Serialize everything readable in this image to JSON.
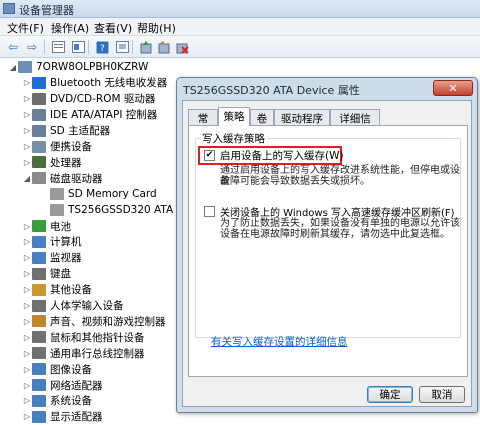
{
  "window": {
    "title": "设备管理器"
  },
  "menu": [
    "文件(F)",
    "操作(A)",
    "查看(V)",
    "帮助(H)"
  ],
  "toolbar": {
    "icons": [
      "back-arrow-icon",
      "forward-arrow-icon",
      "tree-view-icon",
      "properties-icon",
      "help-icon",
      "show-hidden-icon",
      "update-driver-icon",
      "uninstall-icon"
    ],
    "back": "⇦",
    "forward": "⇨"
  },
  "tree": {
    "root": "7ORW8OLPBH0KZRW",
    "items": [
      {
        "label": "Bluetooth 无线电收发器",
        "color": "#1e6fd1"
      },
      {
        "label": "DVD/CD-ROM 驱动器",
        "color": "#6d6d6d"
      },
      {
        "label": "IDE ATA/ATAPI 控制器",
        "color": "#6a7f99"
      },
      {
        "label": "SD 主适配器",
        "color": "#6a7f99"
      },
      {
        "label": "便携设备",
        "color": "#7a8da6"
      },
      {
        "label": "处理器",
        "color": "#4a6d3c"
      },
      {
        "label": "磁盘驱动器",
        "color": "#8a8a8a",
        "expanded": true
      },
      {
        "label": "SD Memory Card",
        "child": true,
        "color": "#9a9a9a"
      },
      {
        "label": "TS256GSSD320 ATA Device",
        "child": true,
        "color": "#9a9a9a"
      },
      {
        "label": "电池",
        "color": "#3b9c3b"
      },
      {
        "label": "计算机",
        "color": "#4a7fc0"
      },
      {
        "label": "监视器",
        "color": "#4a7fc0"
      },
      {
        "label": "键盘",
        "color": "#707070"
      },
      {
        "label": "其他设备",
        "color": "#c89a2c"
      },
      {
        "label": "人体学输入设备",
        "color": "#707070"
      },
      {
        "label": "声音、视频和游戏控制器",
        "color": "#c0862c"
      },
      {
        "label": "鼠标和其他指针设备",
        "color": "#707070"
      },
      {
        "label": "通用串行总线控制器",
        "color": "#707070"
      },
      {
        "label": "图像设备",
        "color": "#4a7fc0"
      },
      {
        "label": "网络适配器",
        "color": "#4a7fc0"
      },
      {
        "label": "系统设备",
        "color": "#4a7fc0"
      },
      {
        "label": "显示适配器",
        "color": "#4a7fc0"
      }
    ]
  },
  "dialog": {
    "title": "TS256GSSD320 ATA Device 属性",
    "close": "✕",
    "tabs": [
      "常规",
      "策略",
      "卷",
      "驱动程序",
      "详细信息"
    ],
    "active_tab": 1,
    "group_title": "写入缓存策略",
    "option1": {
      "label": "启用设备上的写入缓存(W)",
      "checked": true,
      "desc": [
        "通过启用设备上的写入缓存改进系统性能，但停电或设备",
        "故障可能会导致数据丢失或损坏。"
      ]
    },
    "option2": {
      "label": "关闭设备上的 Windows 写入高速缓存缓冲区刷新(F)",
      "checked": false,
      "desc": [
        "为了防止数据丢失，如果设备没有单独的电源以允许该",
        "设备在电源故障时刷新其缓存，请勿选中此复选框。"
      ]
    },
    "link": "有关写入缓存设置的详细信息",
    "ok": "确定",
    "cancel": "取消",
    "highlight_color": "#e02020"
  }
}
